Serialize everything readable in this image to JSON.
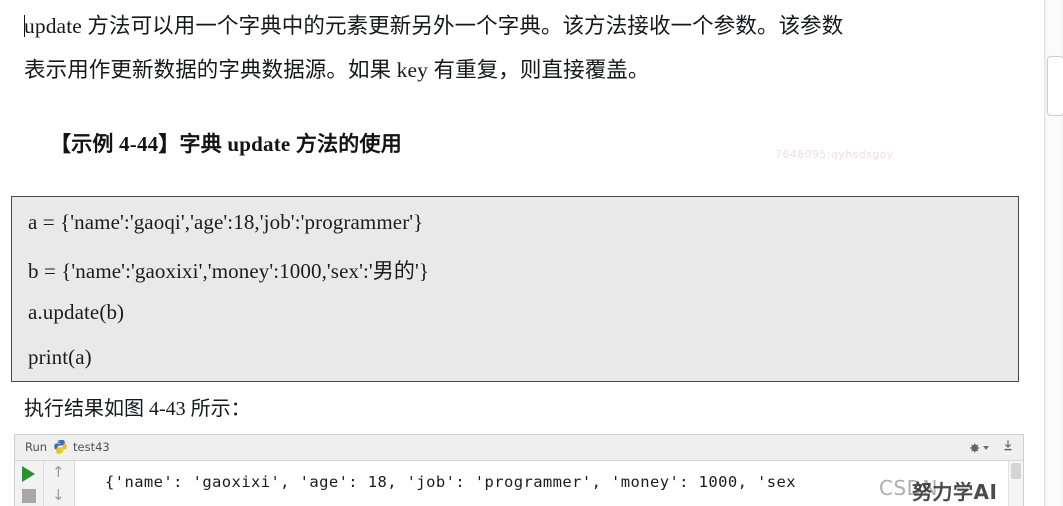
{
  "document": {
    "paragraph_line_1": "update 方法可以用一个字典中的元素更新另外一个字典。该方法接收一个参数。该参数",
    "paragraph_line_2": "表示用作更新数据的字典数据源。如果 key 有重复，则直接覆盖。",
    "heading": "【示例 4-44】字典 update 方法的使用",
    "caption": "执行结果如图 4-43 所示："
  },
  "code_block": {
    "lines": [
      "a = {'name':'gaoqi','age':18,'job':'programmer'}",
      "b = {'name':'gaoxixi','money':1000,'sex':'男的'}",
      "a.update(b)",
      "print(a)"
    ],
    "background_color": "#e9e9e9",
    "border_color": "#4a4a4a"
  },
  "ide": {
    "run_label": "Run",
    "tab_name": "test43",
    "python_icon": "python-logo-icon",
    "gear_icon": "gear-icon",
    "export_icon": "export-icon",
    "dropdown_icon": "chevron-down-icon",
    "run_button_icon": "play-icon",
    "stop_button_icon": "stop-icon",
    "arrow_up_icon": "arrow-up-icon",
    "arrow_down_icon": "arrow-down-icon",
    "arrow_up_glyph": "↑",
    "arrow_down_glyph": "↓",
    "output_line": "{'name': 'gaoxixi', 'age': 18, 'job': 'programmer', 'money': 1000, 'sex",
    "output_line_partial": "",
    "run_arrow_color": "#27922f"
  },
  "watermarks": {
    "faint": "7646095:qyhsdsgoy",
    "csdn": "CSDN",
    "author": "努力学AI"
  }
}
